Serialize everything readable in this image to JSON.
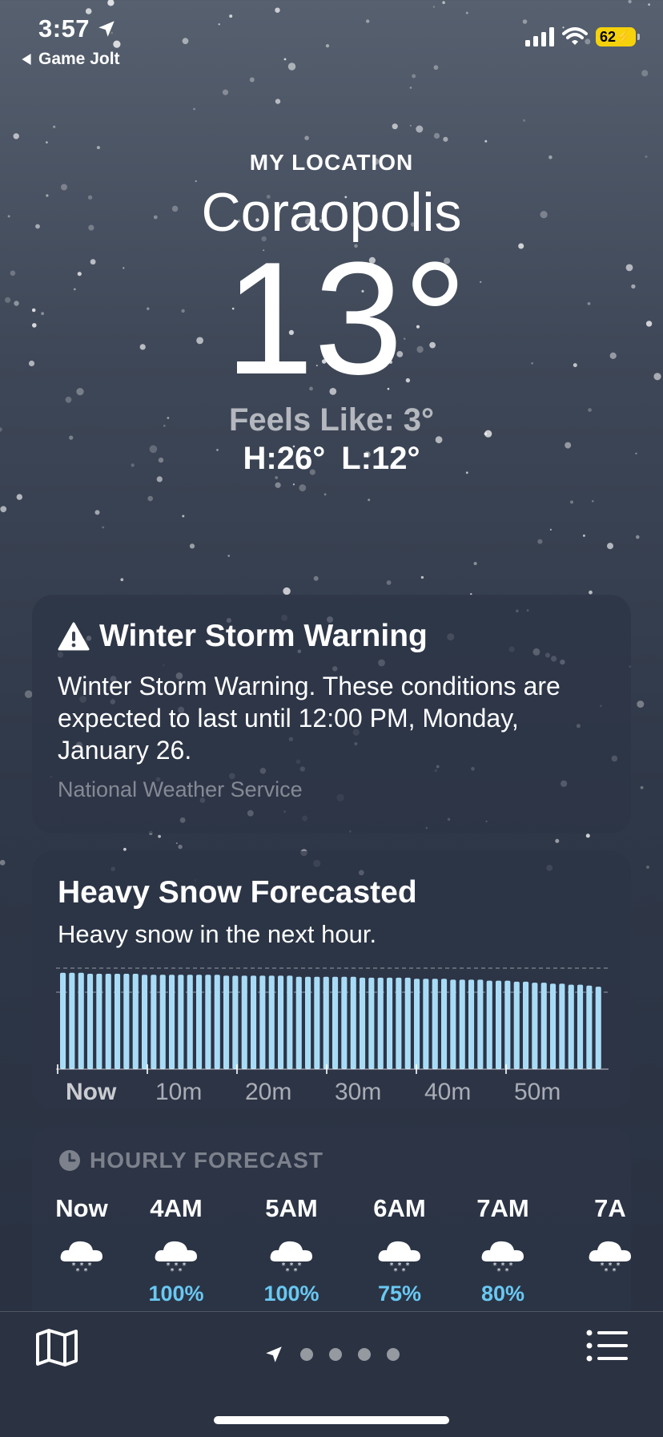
{
  "status_bar": {
    "time": "3:57",
    "back_app": "Game Jolt",
    "battery": "62"
  },
  "header": {
    "location_label": "MY LOCATION",
    "city": "Coraopolis",
    "temperature": "13°",
    "feels_like": "Feels Like: 3°",
    "high": "H:26°",
    "low": "L:12°"
  },
  "alert": {
    "title": "Winter Storm Warning",
    "body": "Winter Storm Warning. These conditions are expected to last until 12:00 PM, Monday, January 26.",
    "source": "National Weather Service"
  },
  "precip_card": {
    "title": "Heavy Snow Forecasted",
    "subtitle": "Heavy snow in the next hour."
  },
  "chart_data": {
    "type": "bar",
    "categories": [
      "Now",
      "10m",
      "20m",
      "30m",
      "40m",
      "50m"
    ],
    "series": [
      {
        "values": [
          0.97,
          0.97,
          0.97,
          0.96,
          0.96,
          0.96,
          0.96,
          0.96,
          0.96,
          0.95,
          0.95,
          0.95,
          0.95,
          0.95,
          0.95,
          0.95,
          0.95,
          0.95,
          0.94,
          0.94,
          0.94,
          0.94,
          0.94,
          0.94,
          0.94,
          0.94,
          0.93,
          0.93,
          0.93,
          0.93,
          0.93,
          0.93,
          0.93,
          0.92,
          0.92,
          0.92,
          0.92,
          0.92,
          0.92,
          0.91,
          0.91,
          0.91,
          0.91,
          0.9,
          0.9,
          0.9,
          0.9,
          0.89,
          0.89,
          0.89,
          0.88,
          0.88,
          0.87,
          0.87,
          0.86,
          0.86,
          0.85,
          0.85,
          0.84,
          0.83
        ]
      }
    ],
    "ylim": [
      0,
      1
    ],
    "grid": true
  },
  "hourly": {
    "title": "HOURLY FORECAST",
    "items": [
      {
        "time": "Now",
        "icon": "snow-cloud-icon",
        "pct": ""
      },
      {
        "time": "4AM",
        "icon": "snow-cloud-icon",
        "pct": "100%"
      },
      {
        "time": "5AM",
        "icon": "snow-cloud-icon",
        "pct": "100%"
      },
      {
        "time": "6AM",
        "icon": "snow-cloud-icon",
        "pct": "75%"
      },
      {
        "time": "7AM",
        "icon": "snow-cloud-icon",
        "pct": "80%"
      },
      {
        "time": "7A",
        "icon": "snow-cloud-icon",
        "pct": ""
      }
    ]
  },
  "colors": {
    "precip_bar": "#a8dcf6",
    "precip_pct": "#69c8f2",
    "battery": "#f5d20b"
  }
}
